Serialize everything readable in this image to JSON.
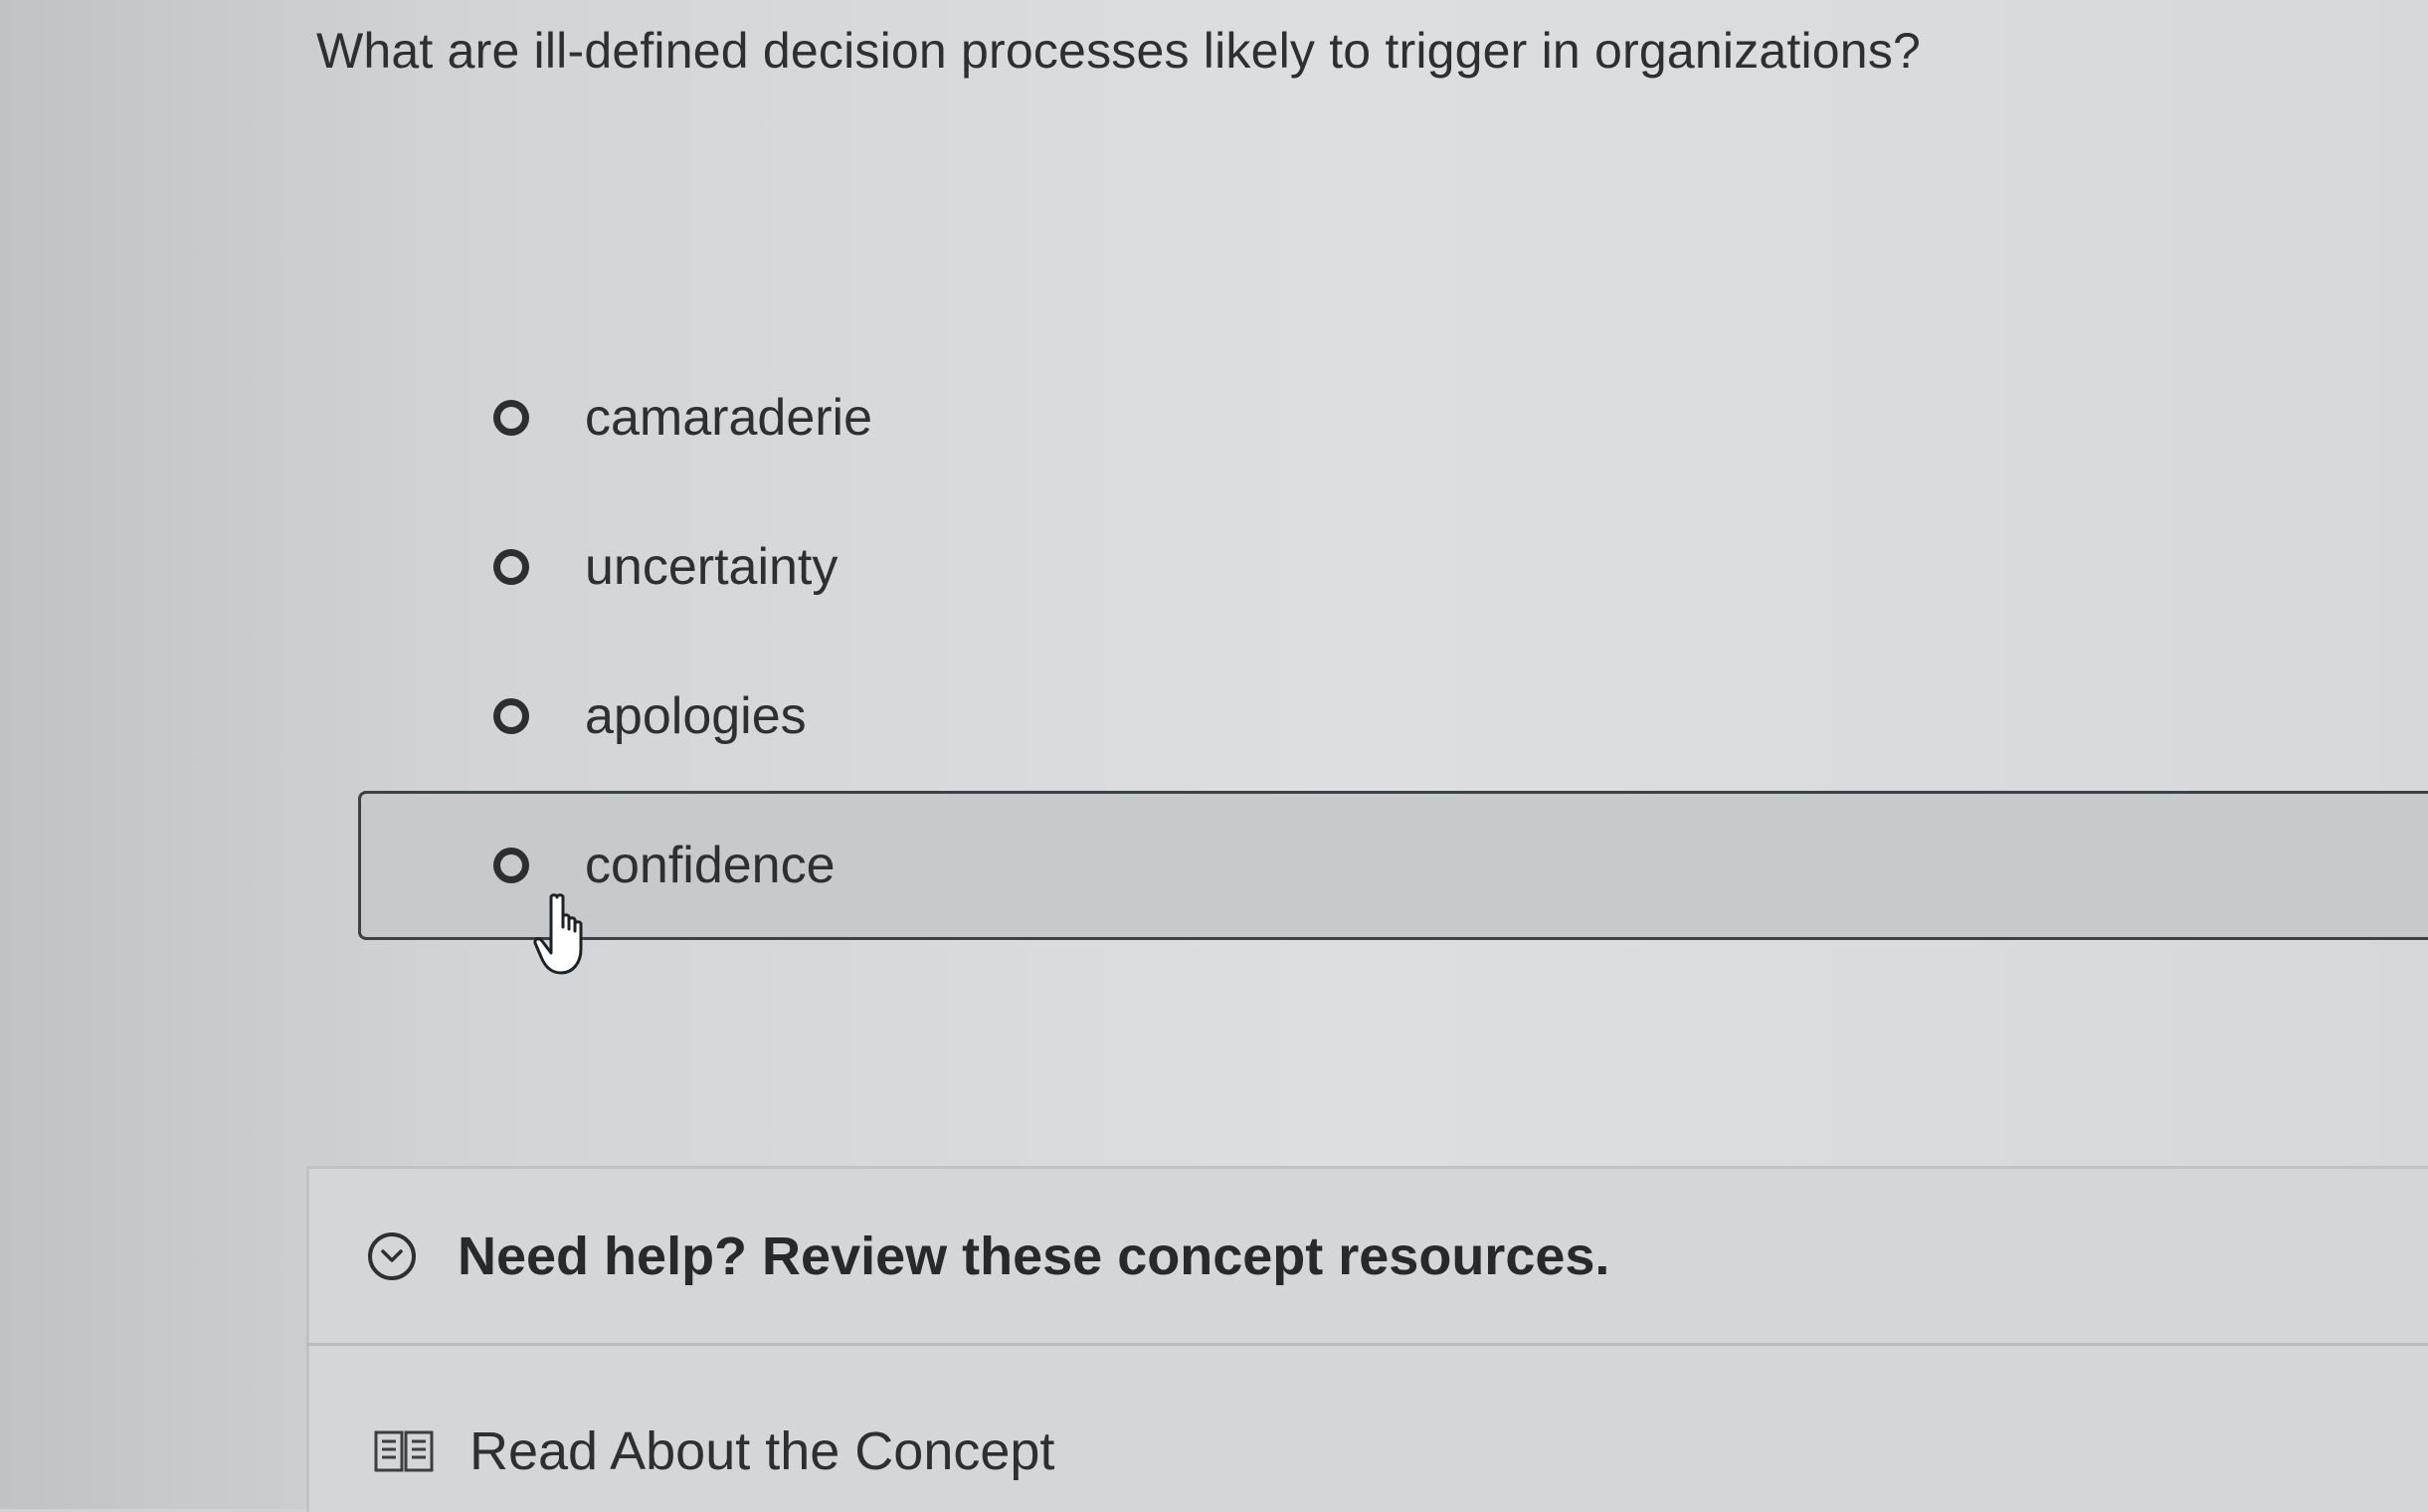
{
  "question": {
    "text": "What are ill-defined decision processes likely to trigger in organizations?"
  },
  "options": [
    {
      "label": "camaraderie",
      "selected": false
    },
    {
      "label": "uncertainty",
      "selected": false
    },
    {
      "label": "apologies",
      "selected": false
    },
    {
      "label": "confidence",
      "selected": false,
      "hovered": true
    }
  ],
  "help": {
    "toggle_label": "Need help? Review these concept resources.",
    "toggle_icon": "chevron-down-circle-icon",
    "read_label": "Read About the Concept",
    "read_icon": "book-icon"
  },
  "cursor": {
    "icon": "hand-pointer-icon"
  }
}
